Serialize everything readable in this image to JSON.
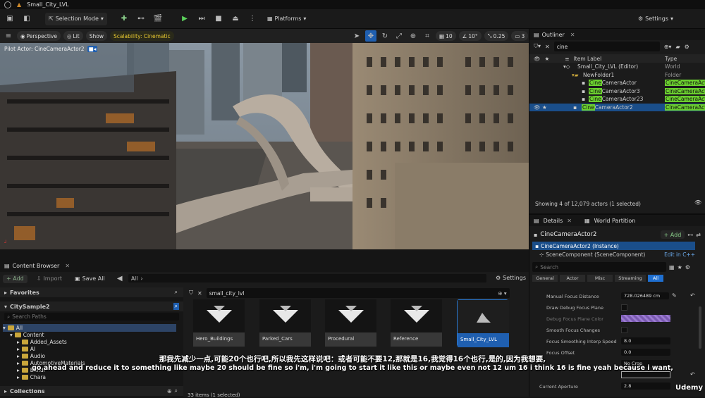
{
  "titlebar": {
    "level_name": "Small_City_LVL"
  },
  "toolbar": {
    "selection_mode": "Selection Mode",
    "platforms": "Platforms",
    "settings": "Settings"
  },
  "viewport": {
    "perspective": "Perspective",
    "lit": "Lit",
    "show": "Show",
    "scalability": "Scalability: Cinematic",
    "grid_snap": "10",
    "rot_snap": "10°",
    "scale_snap": "0.25",
    "cam_speed": "3",
    "pilot_label": "Pilot Actor: CineCameraActor2"
  },
  "outliner": {
    "title": "Outliner",
    "search_value": "cine",
    "col_item": "Item Label",
    "col_type": "Type",
    "rows": [
      {
        "prefix": "",
        "match": "",
        "name": "Small_City_LVL (Editor)",
        "type": "World"
      },
      {
        "prefix": "",
        "match": "",
        "name": "NewFolder1",
        "type": "Folder"
      },
      {
        "prefix": "",
        "match": "Cine",
        "name": "CameraActor",
        "type": "CineCameraAct"
      },
      {
        "prefix": "",
        "match": "Cine",
        "name": "CameraActor3",
        "type": "CineCameraAct"
      },
      {
        "prefix": "",
        "match": "Cine",
        "name": "CameraActor23",
        "type": "CineCameraAct"
      },
      {
        "prefix": "",
        "match": "Cine",
        "name": "CameraActor2",
        "type": "CineCameraAct"
      }
    ],
    "status": "Showing 4 of 12,079 actors (1 selected)"
  },
  "details": {
    "tab_details": "Details",
    "tab_world_partition": "World Partition",
    "actor_name": "CineCameraActor2",
    "add": "+ Add",
    "instance": "CineCameraActor2 (Instance)",
    "scene_component": "SceneComponent (SceneComponent)",
    "edit_cpp": "Edit in C++",
    "search_placeholder": "Search",
    "filters": [
      "General",
      "Actor",
      "Misc",
      "Streaming",
      "All"
    ],
    "props": [
      {
        "label": "Manual Focus Distance",
        "value": "728.026489 cm"
      },
      {
        "label": "Draw Debug Focus Plane",
        "value": ""
      },
      {
        "label": "Debug Focus Plane Color",
        "value": ""
      },
      {
        "label": "Smooth Focus Changes",
        "value": ""
      },
      {
        "label": "Focus Smoothing Interp Speed",
        "value": "8.0"
      },
      {
        "label": "Focus Offset",
        "value": "0.0"
      },
      {
        "label": "",
        "value": "No Crop"
      },
      {
        "label": "Current Aperture",
        "value": "2.8"
      }
    ]
  },
  "content_browser": {
    "title": "Content Browser",
    "add": "+ Add",
    "import": "Import",
    "save_all": "Save All",
    "path": "All",
    "settings": "Settings",
    "favorites": "Favorites",
    "project": "CitySample2",
    "search_paths": "Search Paths",
    "tree": [
      "All",
      "Content",
      "Added_Assets",
      "AI",
      "Audio",
      "AutomotiveMaterials",
      "Buildi",
      "Chara"
    ],
    "collections": "Collections",
    "filter_value": "small_city_lvl",
    "assets": [
      "Hero_Buildings",
      "Parked_Cars",
      "Procedural",
      "Reference",
      "Small_City_LVL"
    ],
    "items_count": "33 items (1 selected)"
  },
  "subtitles": {
    "zh": "那我先减少一点,可能20个也行吧,所以我先这样说吧：或者可能不要12,那就是16,我觉得16个也行,是的,因为我想要,",
    "en": "go ahead and reduce it to something like maybe 20 should be fine so i'm, i'm going to start it like this or maybe even not 12 um 16 i think 16 is fine yeah because i want,"
  },
  "watermark": "Udemy",
  "colors": {
    "accent_green": "#6bcf2f",
    "select_blue": "#1a4e8a",
    "scalability_yellow": "#e8c830"
  }
}
